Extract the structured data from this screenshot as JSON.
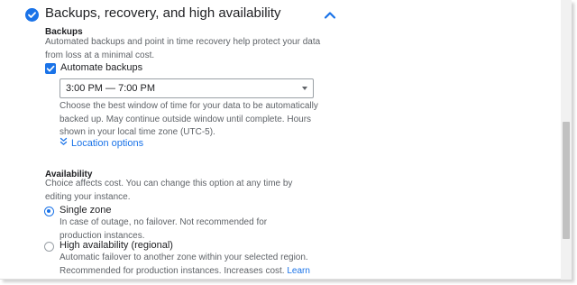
{
  "section": {
    "title": "Backups, recovery, and high availability",
    "collapse_icon": "chevron-up-icon",
    "status_icon": "check-circle-icon"
  },
  "backups": {
    "heading": "Backups",
    "description": "Automated backups and point in time recovery help protect your data from loss at a minimal cost.",
    "automate_checkbox": {
      "label": "Automate backups",
      "checked": true
    },
    "window_select": {
      "value": "3:00 PM — 7:00 PM"
    },
    "window_help": "Choose the best window of time for your data to be automatically backed up. May continue outside window until complete. Hours shown in your local time zone (UTC-5).",
    "location_options": "Location options"
  },
  "availability": {
    "heading": "Availability",
    "description": "Choice affects cost. You can change this option at any time by editing your instance.",
    "options": [
      {
        "label": "Single zone",
        "selected": true,
        "description": "In case of outage, no failover. Not recommended for production instances."
      },
      {
        "label": "High availability (regional)",
        "selected": false,
        "description": "Automatic failover to another zone within your selected region. Recommended for production instances. Increases cost.",
        "link": "Learn more"
      }
    ]
  },
  "colors": {
    "accent": "#1a73e8",
    "text": "#202124",
    "secondary_text": "#5f6368"
  }
}
